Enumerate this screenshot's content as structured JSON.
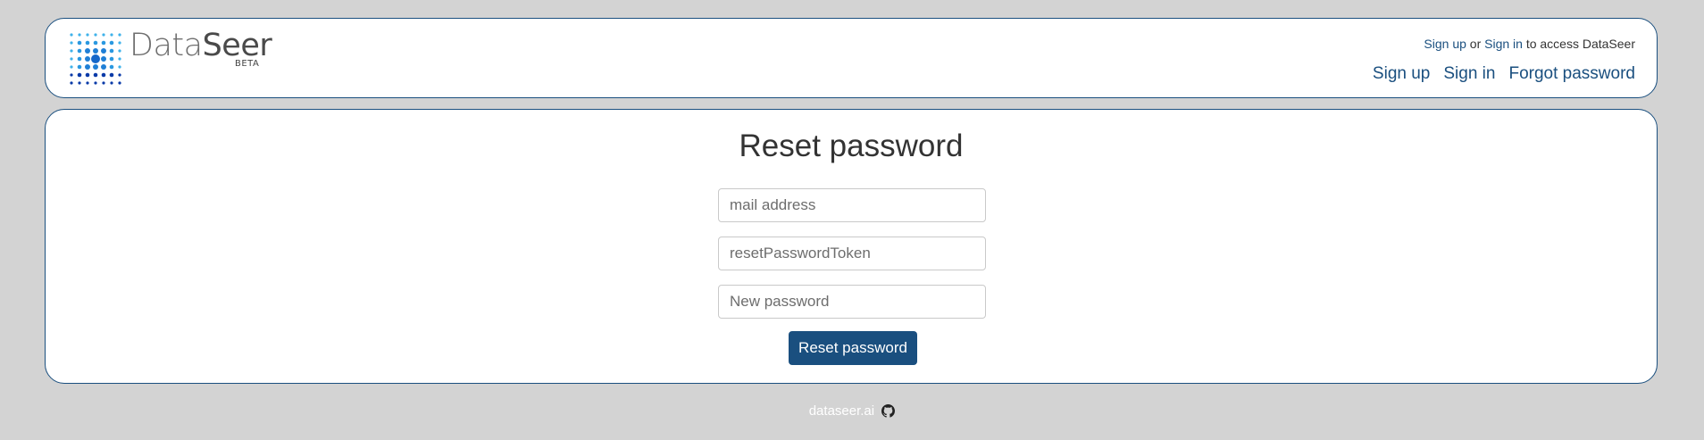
{
  "header": {
    "brand_light": "Data",
    "brand_bold": "Seer",
    "beta": "BETA",
    "access": {
      "signup": "Sign up",
      "or": " or ",
      "signin": "Sign in",
      "suffix": " to access DataSeer"
    },
    "nav": {
      "signup": "Sign up",
      "signin": "Sign in",
      "forgot": "Forgot password"
    }
  },
  "form": {
    "title": "Reset password",
    "email_placeholder": "mail address",
    "token_placeholder": "resetPasswordToken",
    "password_placeholder": "New password",
    "submit_label": "Reset password"
  },
  "footer": {
    "link": "dataseer.ai",
    "icon": "github-icon"
  },
  "colors": {
    "accent": "#1a4f7f",
    "background": "#d3d3d3"
  }
}
